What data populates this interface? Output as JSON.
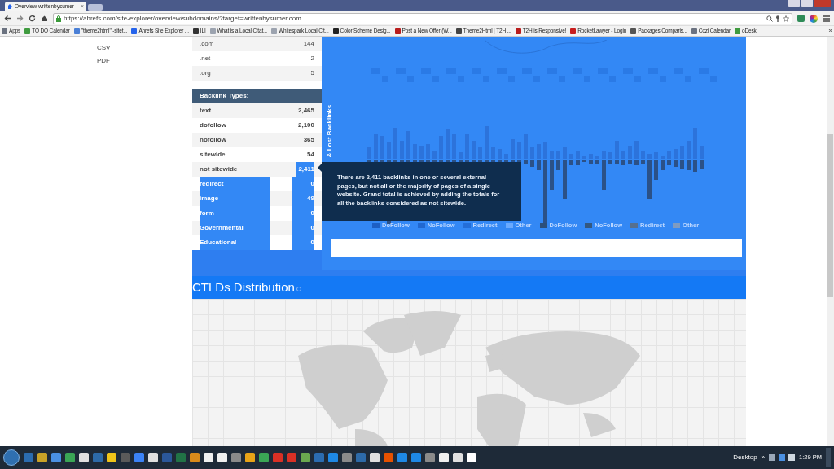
{
  "browser": {
    "tab_title": "Overview writtenbysumer",
    "tab_close": "×",
    "url": "https://ahrefs.com/site-explorer/overview/subdomains/?target=writtenbysumer.com",
    "bookmarks": [
      {
        "label": "Apps",
        "color": "#6b7280"
      },
      {
        "label": "TO DO Calendar",
        "color": "#3f9b3f"
      },
      {
        "label": "\"theme2html\" -sitet...",
        "color": "#4a7fd6"
      },
      {
        "label": "Ahrefs Site Explorer ...",
        "color": "#2563eb"
      },
      {
        "label": "ILI",
        "color": "#333333"
      },
      {
        "label": "What is a Local Citat...",
        "color": "#9ca3af"
      },
      {
        "label": "Whitespark Local Cit...",
        "color": "#9ca3af"
      },
      {
        "label": "Color Scheme Desig...",
        "color": "#222222"
      },
      {
        "label": "Post a New Offer (W...",
        "color": "#b91c1c"
      },
      {
        "label": "Theme2Html | T2H ...",
        "color": "#444444"
      },
      {
        "label": "T2H is Responsive!",
        "color": "#b91c1c"
      },
      {
        "label": "RocketLawyer - Login",
        "color": "#c81e1e"
      },
      {
        "label": "Packages Comparis...",
        "color": "#555555"
      },
      {
        "label": "Cozi Calendar",
        "color": "#6b7280"
      },
      {
        "label": "oDesk",
        "color": "#3f9b3f"
      }
    ],
    "more": "»"
  },
  "sidebar": {
    "items": [
      "CSV",
      "PDF"
    ]
  },
  "tld_table": {
    "rows": [
      {
        "label": ".com",
        "value": "144"
      },
      {
        "label": ".net",
        "value": "2"
      },
      {
        "label": ".org",
        "value": "5"
      }
    ]
  },
  "backlink_types": {
    "title": "Backlink Types:",
    "rows": [
      {
        "label": "text",
        "value": "2,465",
        "label_highlighted": false,
        "value_highlighted": false
      },
      {
        "label": "dofollow",
        "value": "2,100",
        "label_highlighted": false,
        "value_highlighted": false
      },
      {
        "label": "nofollow",
        "value": "365",
        "label_highlighted": false,
        "value_highlighted": false
      },
      {
        "label": "sitewide",
        "value": "54",
        "label_highlighted": false,
        "value_highlighted": false
      },
      {
        "label": "not sitewide",
        "value": "2,411",
        "label_highlighted": false,
        "value_highlighted": true
      },
      {
        "label": "redirect",
        "value": "0",
        "label_highlighted": true,
        "value_highlighted": true
      },
      {
        "label": "image",
        "value": "49",
        "label_highlighted": true,
        "value_highlighted": true
      },
      {
        "label": "form",
        "value": "0",
        "label_highlighted": true,
        "value_highlighted": true
      },
      {
        "label": "Governmental",
        "value": "0",
        "label_highlighted": true,
        "value_highlighted": true
      },
      {
        "label": "Educational",
        "value": "0",
        "label_highlighted": true,
        "value_highlighted": true
      }
    ]
  },
  "chart": {
    "axis_label": "& Lost Backlinks",
    "legend": [
      {
        "label": "DoFollow",
        "color": "#1d5fc4"
      },
      {
        "label": "NoFollow",
        "color": "#2168d0"
      },
      {
        "label": "Redirect",
        "color": "#246ed8"
      },
      {
        "label": "Other",
        "color": "#6aaaff"
      },
      {
        "label": "DoFollow",
        "color": "#2c4f7a"
      },
      {
        "label": "NoFollow",
        "color": "#34587f"
      },
      {
        "label": "Redirect",
        "color": "#56708f"
      },
      {
        "label": "Other",
        "color": "#7f9bc0"
      }
    ]
  },
  "tooltip": {
    "text": "There are 2,411 backlinks in one or several external pages, but not all or the majority of pages of a single website. Grand total is achieved by adding the totals for all the backlinks considered as not sitewide."
  },
  "section": {
    "title": "CTLDs Distribution"
  },
  "taskbar": {
    "desktop_label": "Desktop",
    "more": "»",
    "clock": "1:29 PM"
  }
}
